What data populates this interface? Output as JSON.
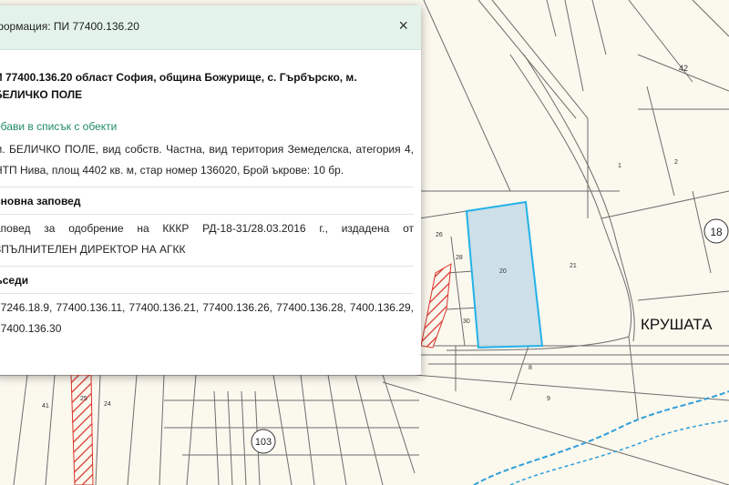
{
  "popup": {
    "title": "формация: ПИ 77400.136.20",
    "close": "×",
    "heading": "И 77400.136.20 област София, община Божурище, с. Гърбърско, м. БЕЛИЧКО ПОЛЕ",
    "add_link": "обави в списък с обекти",
    "details": "м. БЕЛИЧКО ПОЛЕ, вид собств. Частна, вид територия Земеделска, атегория 4, НТП Нива, площ 4402 кв. м, стар номер 136020, Брой ъкрове: 10 бр.",
    "order_title": "сновна заповед",
    "order_text": "аповед за одобрение на КККР РД-18-31/28.03.2016 г., издадена от ЗПЪЛНИТЕЛЕН ДИРЕКТОР НА АГКК",
    "neighbours_title": "ъседи",
    "neighbours_text": "77246.18.9, 77400.136.11, 77400.136.21, 77400.136.26, 77400.136.28, 7400.136.29, 77400.136.30"
  },
  "map": {
    "area_label": "КРУШАТА",
    "circle_labels": [
      "18",
      "103"
    ],
    "parcel_labels": [
      "42",
      "1",
      "21",
      "20",
      "26",
      "28",
      "30",
      "25",
      "41",
      "24",
      "8",
      "9",
      "2"
    ],
    "colors": {
      "background": "#fbf8ee",
      "parcel_line": "#6d6d6d",
      "selected_fill": "#c4dbe6",
      "selected_stroke": "#22b2e8",
      "hatch": "#d9342b",
      "water": "#2f9fd8"
    }
  }
}
